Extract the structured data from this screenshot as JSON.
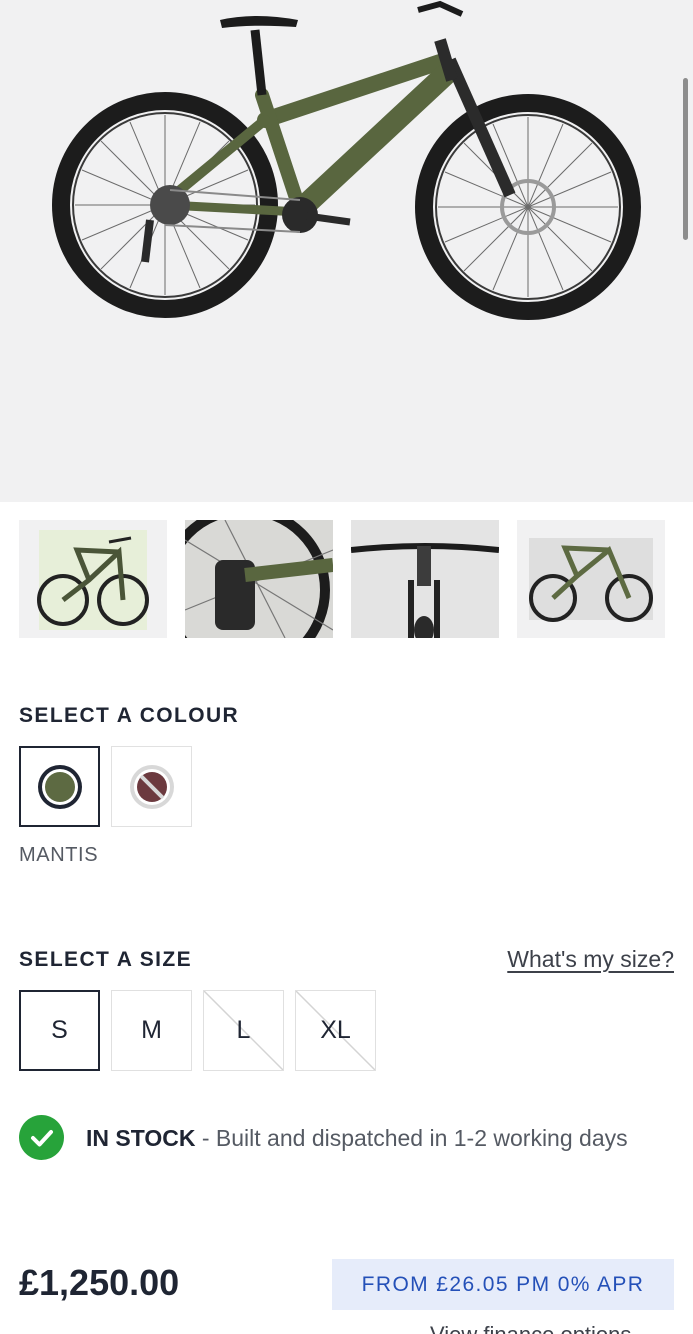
{
  "gallery": {
    "thumbnails": [
      "bike-angle-view",
      "rear-derailleur-detail",
      "handlebar-front-view",
      "bike-outdoor-view"
    ]
  },
  "colour": {
    "heading": "SELECT A COLOUR",
    "selected_name": "MANTIS",
    "options": [
      {
        "name": "MANTIS",
        "hex": "#5d6a42",
        "available": true
      },
      {
        "name": "",
        "hex": "#6c3a3f",
        "available": false
      }
    ]
  },
  "size": {
    "heading": "SELECT A SIZE",
    "guide_link": "What's my size?",
    "options": [
      {
        "label": "S",
        "available": true,
        "selected": true
      },
      {
        "label": "M",
        "available": true,
        "selected": false
      },
      {
        "label": "L",
        "available": false,
        "selected": false
      },
      {
        "label": "XL",
        "available": false,
        "selected": false
      }
    ]
  },
  "stock": {
    "status": "IN STOCK",
    "detail": " - Built and dispatched in 1-2 working days"
  },
  "pricing": {
    "price": "£1,250.00",
    "finance_badge": "FROM £26.05 PM 0% APR",
    "finance_link": "View finance options"
  },
  "colors": {
    "accent_green": "#27a33a",
    "finance_bg": "#e6ecfa",
    "finance_text": "#2450b8"
  }
}
